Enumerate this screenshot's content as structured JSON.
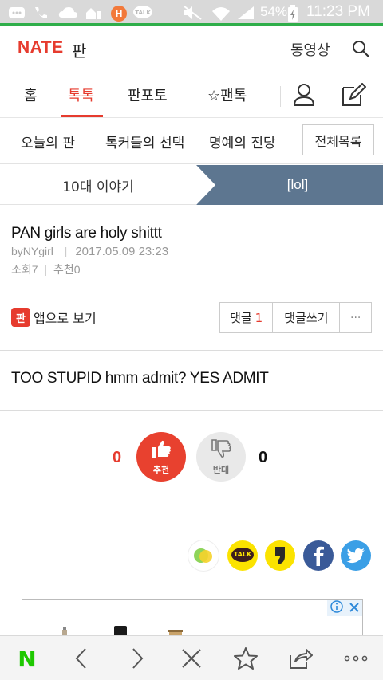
{
  "status_bar": {
    "battery": "54%",
    "time": "11:23 PM"
  },
  "header": {
    "brand": "NATE",
    "section": "판",
    "video_link": "동영상"
  },
  "tabs": [
    {
      "label": "홈"
    },
    {
      "label": "톡톡"
    },
    {
      "label": "판포토"
    },
    {
      "label": "☆팬톡"
    }
  ],
  "subnav": {
    "items": [
      "오늘의 판",
      "톡커들의 선택",
      "명예의 전당"
    ],
    "all_button": "전체목록"
  },
  "breadcrumb": {
    "left": "10대 이야기",
    "right": "[lol]"
  },
  "post": {
    "title": "PAN girls are holy shittt",
    "author": "byNYgirl",
    "date": "2017.05.09 23:23",
    "views_label": "조회",
    "views": "7",
    "recommend_label": "추천",
    "recommend": "0",
    "body": "TOO STUPID hmm admit? YES ADMIT"
  },
  "actions": {
    "app_icon": "판",
    "app_view": "앱으로 보기",
    "comments_label": "댓글",
    "comments_count": "1",
    "write_comment": "댓글쓰기",
    "more": "···"
  },
  "votes": {
    "up_count": "0",
    "up_label": "추천",
    "down_label": "반대",
    "down_count": "0"
  },
  "share": {
    "kakaotalk_label": "TALK"
  },
  "bottom_bar": {
    "home_logo": "N"
  },
  "colors": {
    "brand_red": "#e63b2e",
    "breadcrumb_blue": "#5d7690",
    "status_green": "#2fae4a"
  }
}
